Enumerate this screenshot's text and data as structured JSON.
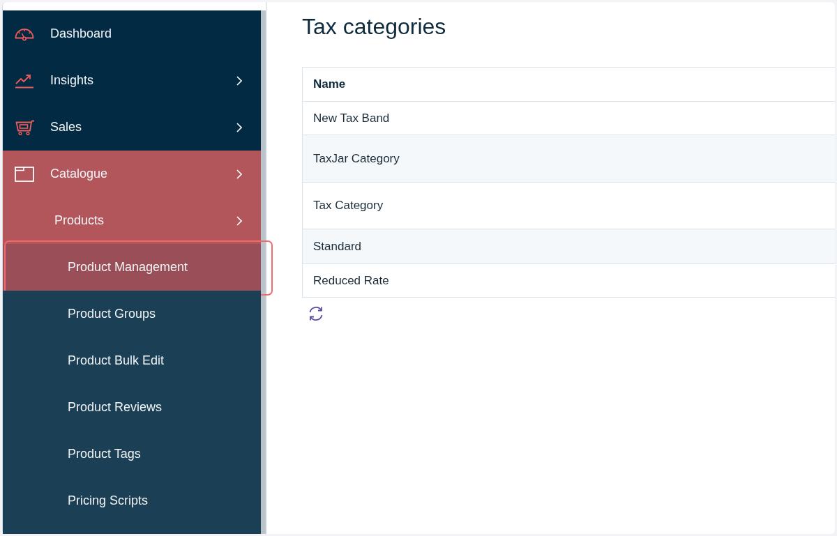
{
  "sidebar": {
    "items": [
      {
        "label": "Dashboard",
        "expandable": false,
        "active": false
      },
      {
        "label": "Insights",
        "expandable": true,
        "active": false
      },
      {
        "label": "Sales",
        "expandable": true,
        "active": false
      },
      {
        "label": "Catalogue",
        "expandable": true,
        "active": true,
        "children": [
          {
            "label": "Products",
            "expandable": true,
            "active": true,
            "children": [
              {
                "label": "Product Management",
                "selected": true
              },
              {
                "label": "Product Groups",
                "selected": false
              },
              {
                "label": "Product Bulk Edit",
                "selected": false
              },
              {
                "label": "Product Reviews",
                "selected": false
              },
              {
                "label": "Product Tags",
                "selected": false
              },
              {
                "label": "Pricing Scripts",
                "selected": false
              }
            ]
          }
        ]
      }
    ]
  },
  "page": {
    "title": "Tax categories"
  },
  "table": {
    "columns": [
      "Name"
    ],
    "rows": [
      [
        "New Tax Band"
      ],
      [
        "TaxJar Category"
      ],
      [
        "Tax Category"
      ],
      [
        "Standard"
      ],
      [
        "Reduced Rate"
      ]
    ]
  }
}
